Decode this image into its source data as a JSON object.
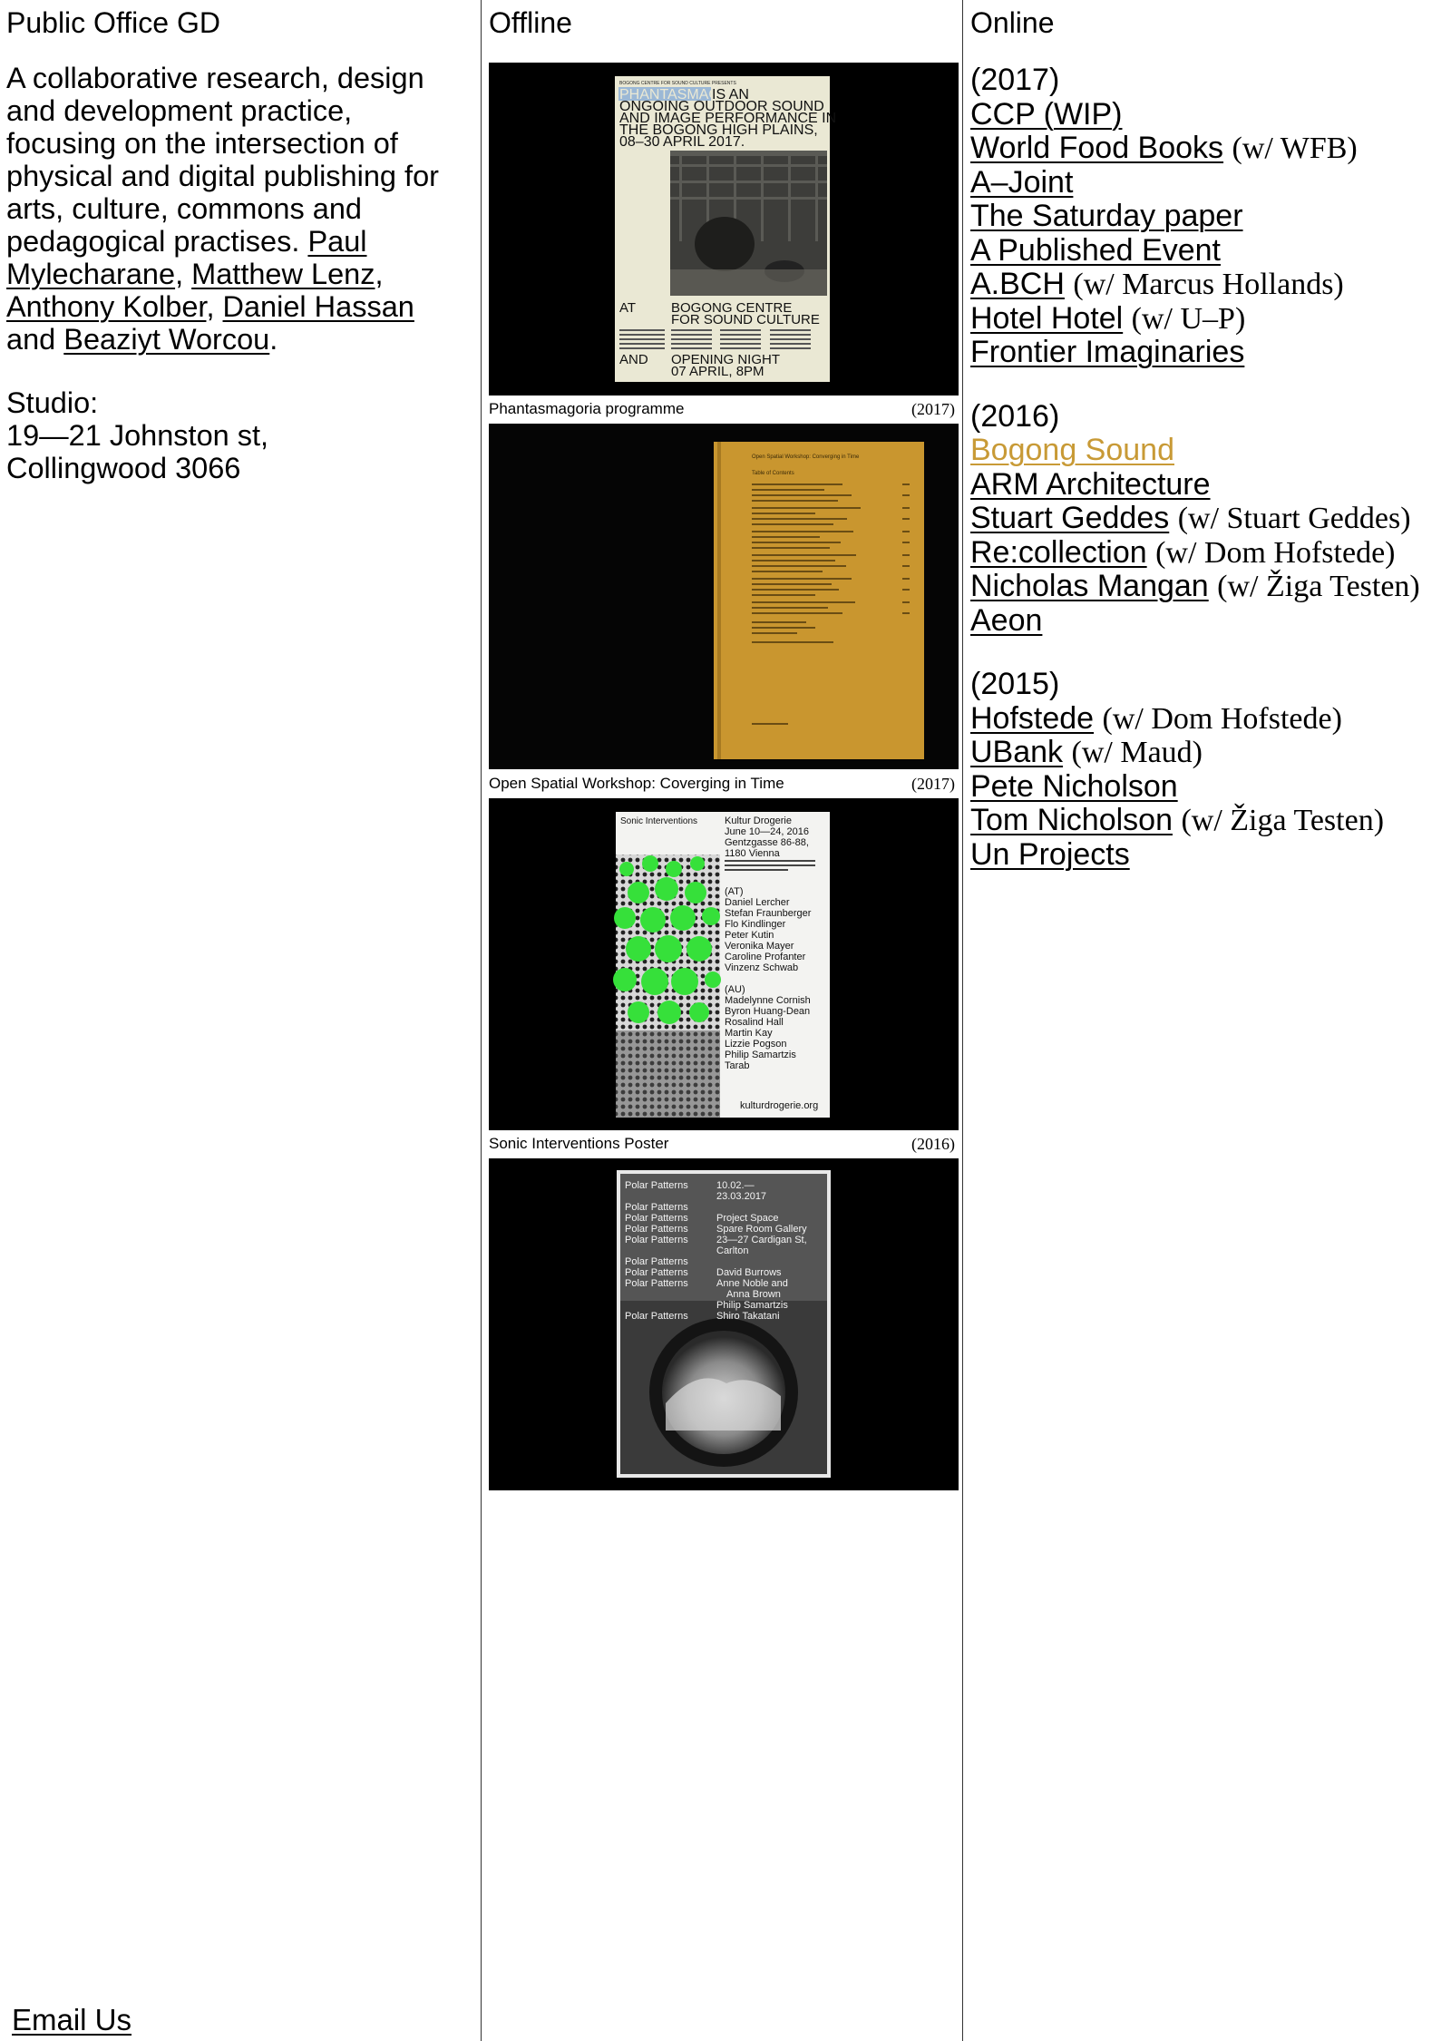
{
  "left": {
    "heading": "Public Office GD",
    "about_text": "A collaborative research, design and development practice, focusing on the intersection of physical and digital publishing for arts, culture, commons and pedagogical practises.",
    "people": [
      "Paul Mylecharane",
      "Matthew Lenz",
      "Anthony Kolber",
      "Daniel Hassan",
      "Beaziyt Worcou"
    ],
    "sep_comma": ",",
    "sep_and": "and",
    "end_period": ".",
    "studio_label": "Studio:",
    "studio_line1": "19—21 Johnston st,",
    "studio_line2": "Collingwood 3066",
    "email_label": "Email Us"
  },
  "middle": {
    "heading": "Offline",
    "projects": [
      {
        "caption": "Phantasmagoria programme",
        "year": "(2017)"
      },
      {
        "caption": "Open Spatial Workshop: Coverging in Time",
        "year": "(2017)"
      },
      {
        "caption": "Sonic Interventions Poster",
        "year": "(2016)"
      },
      {
        "caption": "",
        "year": ""
      }
    ],
    "poster1": {
      "small_top": "BOGONG CENTRE FOR SOUND CULTURE PRESENTS",
      "title_highlight": "PHANTASMAGORIA",
      "title_rest1": " IS AN",
      "title_line2": "ONGOING OUTDOOR SOUND",
      "title_line3": "AND IMAGE PERFORMANCE IN",
      "title_line4": "THE BOGONG HIGH PLAINS,",
      "title_line5": "08–30 APRIL 2017.",
      "at": "AT",
      "venue1": "BOGONG CENTRE",
      "venue2": "FOR SOUND CULTURE",
      "and": "AND",
      "night1": "OPENING NIGHT",
      "night2": "07 APRIL, 8PM"
    },
    "poster2": {
      "title": "Open Spatial Workshop: Converging in Time",
      "toc": "Table of Contents"
    },
    "poster3": {
      "left_title": "Sonic Interventions",
      "venue": "Kultur Drogerie",
      "dates": "June 10—24, 2016",
      "addr1": "Gentzgasse 86-88,",
      "addr2": "1180 Vienna",
      "at_label": "(AT)",
      "at_names": [
        "Daniel Lercher",
        "Stefan Fraunberger",
        "Flo Kindlinger",
        "Peter Kutin",
        "Veronika Mayer",
        "Caroline Profanter",
        "Vinzenz Schwab"
      ],
      "au_label": "(AU)",
      "au_names": [
        "Madelynne Cornish",
        "Byron Huang-Dean",
        "Rosalind Hall",
        "Martin Kay",
        "Lizzie Pogson",
        "Philip Samartzis",
        "Tarab"
      ],
      "url": "kulturdrogerie.org"
    },
    "poster4": {
      "title": "Polar Patterns",
      "date1": "10.02.—",
      "date2": "23.03.2017",
      "venue1": "Project Space",
      "venue2": "Spare Room Gallery",
      "venue3": "23—27 Cardigan St,",
      "venue4": "Carlton",
      "artist1": "David Burrows",
      "artist2": "Anne Noble and",
      "artist3": "Anna Brown",
      "artist4": "Philip Samartzis",
      "artist5": "Shiro Takatani"
    }
  },
  "right": {
    "heading": "Online",
    "groups": [
      {
        "year": "(2017)",
        "entries": [
          {
            "name": "CCP (WIP)",
            "collab": ""
          },
          {
            "name": "World Food Books",
            "collab": "(w/ WFB)"
          },
          {
            "name": "A–Joint",
            "collab": ""
          },
          {
            "name": "The Saturday paper",
            "collab": ""
          },
          {
            "name": "A Published Event",
            "collab": ""
          },
          {
            "name": "A.BCH",
            "collab": "(w/ Marcus Hollands)"
          },
          {
            "name": "Hotel Hotel",
            "collab": "(w/ U–P)"
          },
          {
            "name": "Frontier Imaginaries",
            "collab": ""
          }
        ]
      },
      {
        "year": "(2016)",
        "entries": [
          {
            "name": "Bogong Sound",
            "collab": "",
            "active": true
          },
          {
            "name": "ARM Architecture",
            "collab": ""
          },
          {
            "name": "Stuart Geddes",
            "collab": "(w/ Stuart Geddes)"
          },
          {
            "name": "Re:collection",
            "collab": "(w/ Dom Hofstede)"
          },
          {
            "name": "Nicholas Mangan",
            "collab": "(w/ Žiga Testen)"
          },
          {
            "name": "Aeon",
            "collab": ""
          }
        ]
      },
      {
        "year": "(2015)",
        "entries": [
          {
            "name": "Hofstede",
            "collab": "(w/ Dom Hofstede)"
          },
          {
            "name": "UBank",
            "collab": "(w/ Maud)"
          },
          {
            "name": "Pete Nicholson",
            "collab": ""
          },
          {
            "name": "Tom Nicholson",
            "collab": "(w/ Žiga Testen)"
          },
          {
            "name": "Un Projects",
            "collab": ""
          }
        ]
      }
    ],
    "colors": {
      "active_link": "#c89a36"
    }
  }
}
